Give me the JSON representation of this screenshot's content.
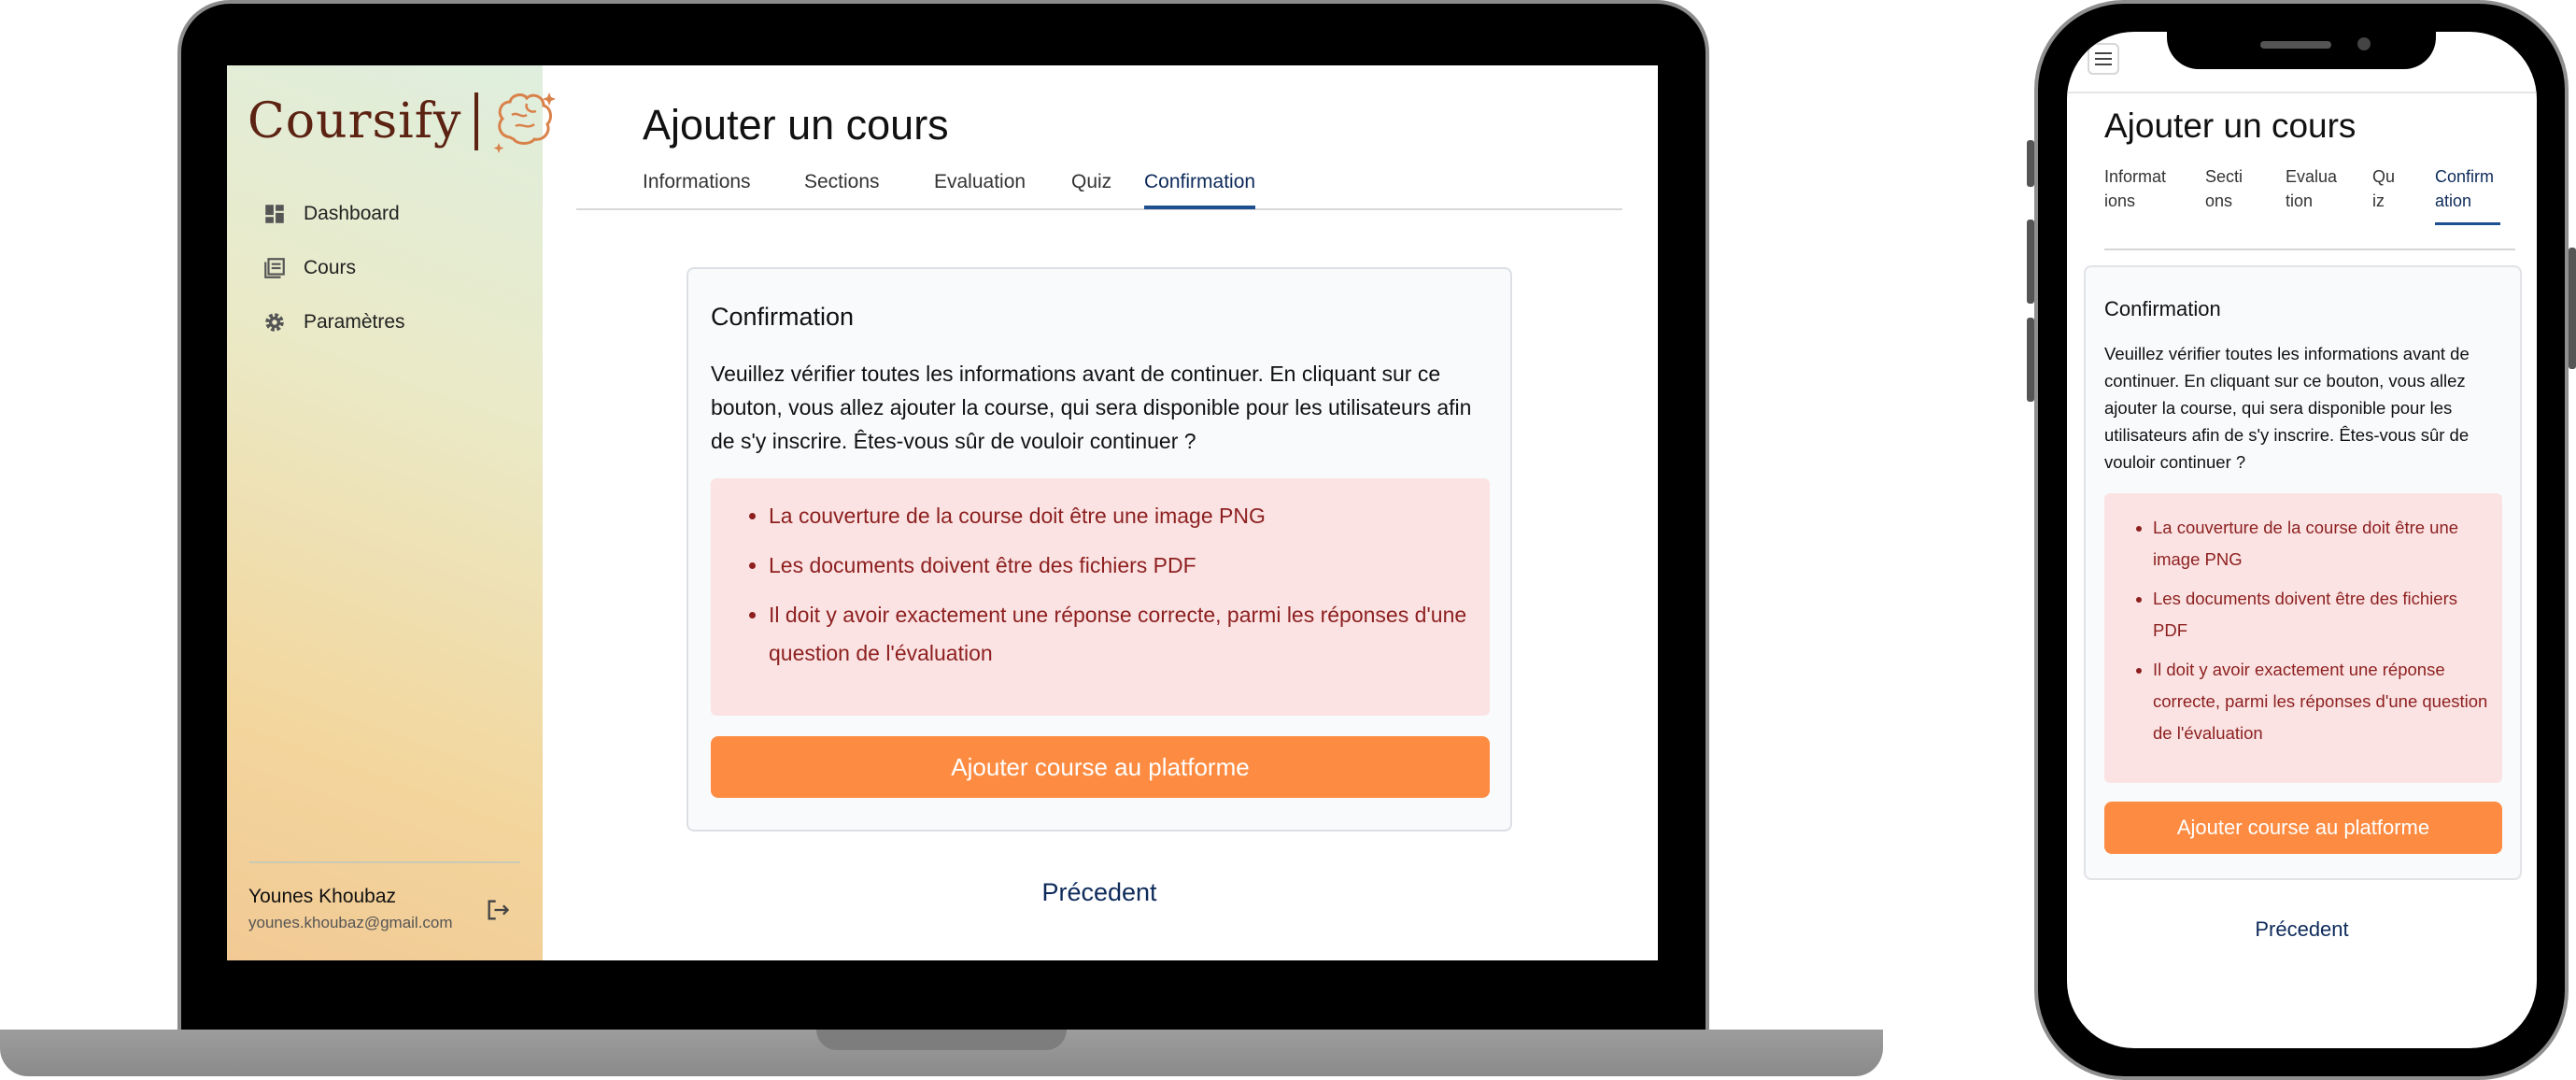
{
  "app": {
    "brand": "Coursify"
  },
  "sidebar": {
    "items": [
      {
        "label": "Dashboard",
        "icon": "dashboard-icon"
      },
      {
        "label": "Cours",
        "icon": "book-icon"
      },
      {
        "label": "Paramètres",
        "icon": "gear-icon"
      }
    ],
    "user": {
      "name": "Younes Khoubaz",
      "email": "younes.khoubaz@gmail.com"
    }
  },
  "page": {
    "title": "Ajouter un cours",
    "tabs": [
      "Informations",
      "Sections",
      "Evaluation",
      "Quiz",
      "Confirmation"
    ],
    "active_tab": "Confirmation"
  },
  "confirmation": {
    "title": "Confirmation",
    "message": "Veuillez vérifier toutes les informations avant de continuer. En cliquant sur ce bouton, vous allez ajouter la course, qui sera disponible pour les utilisateurs afin de s'y inscrire. Êtes-vous sûr de vouloir continuer ?",
    "errors": [
      "La couverture de la course doit être une image PNG",
      "Les documents doivent être des fichiers PDF",
      "Il doit y avoir exactement une réponse correcte, parmi les réponses d'une question de l'évaluation"
    ],
    "submit_label": "Ajouter course au platforme",
    "previous_label": "Précedent"
  },
  "mobile": {
    "tabs": [
      "Informat ions",
      "Secti ons",
      "Evalua tion",
      "Qu iz",
      "Confirm ation"
    ]
  },
  "colors": {
    "accent": "#fd8c42",
    "active_tab": "#1d4f91",
    "error_bg": "#fbe3e3",
    "error_text": "#8d1f1f",
    "brand": "#5c2212"
  }
}
